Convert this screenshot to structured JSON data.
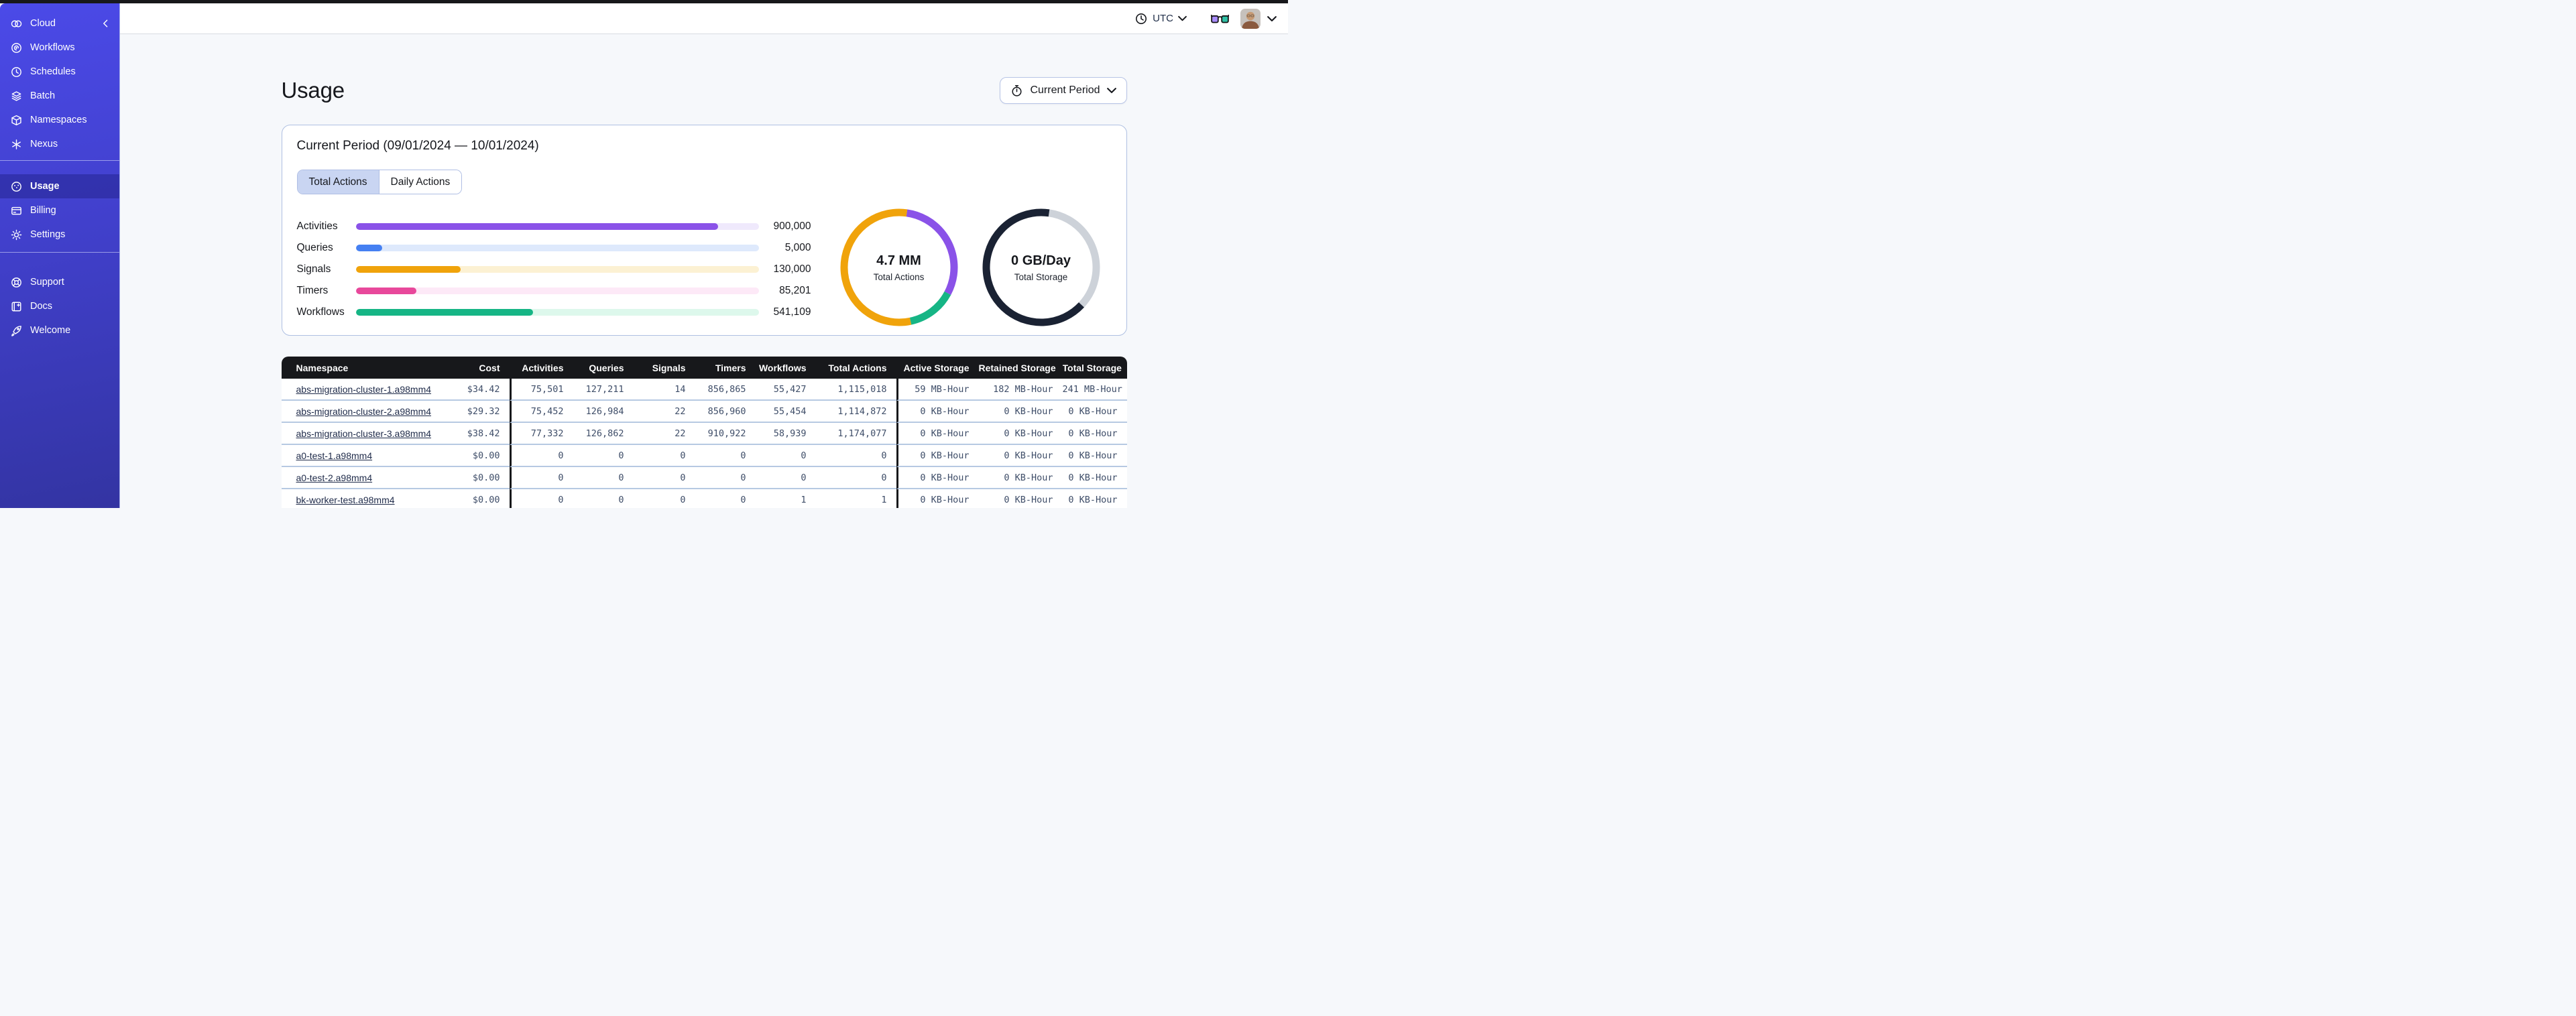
{
  "topbar": {
    "timezone_label": "UTC"
  },
  "sidebar": {
    "brand": {
      "label": "Cloud",
      "icon": "temporal-logo-icon"
    },
    "nav_items": [
      {
        "label": "Workflows",
        "icon": "workflows-icon",
        "active": false
      },
      {
        "label": "Schedules",
        "icon": "schedules-icon",
        "active": false
      },
      {
        "label": "Batch",
        "icon": "batch-icon",
        "active": false
      },
      {
        "label": "Namespaces",
        "icon": "namespaces-icon",
        "active": false
      },
      {
        "label": "Nexus",
        "icon": "nexus-icon",
        "active": false
      }
    ],
    "account_items": [
      {
        "label": "Usage",
        "icon": "usage-icon",
        "active": true
      },
      {
        "label": "Billing",
        "icon": "billing-icon",
        "active": false
      },
      {
        "label": "Settings",
        "icon": "settings-icon",
        "active": false
      }
    ],
    "help_items": [
      {
        "label": "Support",
        "icon": "support-icon",
        "active": false
      },
      {
        "label": "Docs",
        "icon": "docs-icon",
        "active": false
      },
      {
        "label": "Welcome",
        "icon": "welcome-icon",
        "active": false
      }
    ]
  },
  "main": {
    "title": "Usage",
    "period_button_label": "Current Period",
    "card": {
      "title": "Current Period (09/01/2024 — 10/01/2024)",
      "tabs": [
        {
          "label": "Total Actions",
          "active": true
        },
        {
          "label": "Daily Actions",
          "active": false
        }
      ]
    }
  },
  "chart_data": [
    {
      "type": "bar",
      "title": "Total Actions by type",
      "categories": [
        "Activities",
        "Queries",
        "Signals",
        "Timers",
        "Workflows"
      ],
      "values": [
        900000,
        5000,
        130000,
        85201,
        541109
      ],
      "value_labels": [
        "900,000",
        "5,000",
        "130,000",
        "85,201",
        "541,109"
      ],
      "fill_fractions": [
        0.9,
        0.066,
        0.26,
        0.15,
        0.44
      ],
      "bar_colors": [
        "#8A52E8",
        "#4580F2",
        "#F0A30B",
        "#E8489B",
        "#16B585"
      ],
      "track_colors": [
        "#EFE9FC",
        "#DEE9FC",
        "#FCF1D3",
        "#FDE9F7",
        "#DDF8EC"
      ]
    },
    {
      "type": "pie",
      "center_value": "4.7 MM",
      "center_label": "Total Actions",
      "start_deg": 8,
      "slices": [
        {
          "color": "#8A52E8",
          "deg": 110
        },
        {
          "color": "#16B585",
          "deg": 50
        },
        {
          "color": "#F0A30B",
          "deg": 200
        }
      ]
    },
    {
      "type": "pie",
      "center_value": "0 GB/Day",
      "center_label": "Total Storage",
      "start_deg": 8,
      "slices": [
        {
          "color": "#CDD2D9",
          "deg": 125
        },
        {
          "color": "#1A2233",
          "deg": 235
        }
      ]
    }
  ],
  "table": {
    "headers": [
      "Namespace",
      "Cost",
      "Activities",
      "Queries",
      "Signals",
      "Timers",
      "Workflows",
      "Total Actions",
      "Active Storage",
      "Retained Storage",
      "Total Storage"
    ],
    "rows": [
      [
        "abs-migration-cluster-1.a98mm4",
        "$34.42",
        "75,501",
        "127,211",
        "14",
        "856,865",
        "55,427",
        "1,115,018",
        "59 MB-Hour",
        "182 MB-Hour",
        "241 MB-Hour"
      ],
      [
        "abs-migration-cluster-2.a98mm4",
        "$29.32",
        "75,452",
        "126,984",
        "22",
        "856,960",
        "55,454",
        "1,114,872",
        "0 KB-Hour",
        "0 KB-Hour",
        "0 KB-Hour"
      ],
      [
        "abs-migration-cluster-3.a98mm4",
        "$38.42",
        "77,332",
        "126,862",
        "22",
        "910,922",
        "58,939",
        "1,174,077",
        "0 KB-Hour",
        "0 KB-Hour",
        "0 KB-Hour"
      ],
      [
        "a0-test-1.a98mm4",
        "$0.00",
        "0",
        "0",
        "0",
        "0",
        "0",
        "0",
        "0 KB-Hour",
        "0 KB-Hour",
        "0 KB-Hour"
      ],
      [
        "a0-test-2.a98mm4",
        "$0.00",
        "0",
        "0",
        "0",
        "0",
        "0",
        "0",
        "0 KB-Hour",
        "0 KB-Hour",
        "0 KB-Hour"
      ],
      [
        "bk-worker-test.a98mm4",
        "$0.00",
        "0",
        "0",
        "0",
        "0",
        "1",
        "1",
        "0 KB-Hour",
        "0 KB-Hour",
        "0 KB-Hour"
      ]
    ]
  }
}
